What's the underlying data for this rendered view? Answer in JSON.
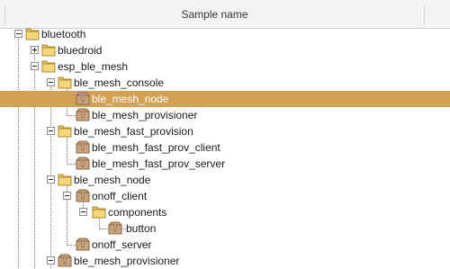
{
  "header": {
    "column_title": "Sample name"
  },
  "tree": {
    "items": [
      {
        "label": "bluetooth",
        "icon": "folder-icon",
        "expander": "minus"
      },
      {
        "label": "bluedroid",
        "icon": "folder-icon",
        "expander": "plus"
      },
      {
        "label": "esp_ble_mesh",
        "icon": "folder-icon",
        "expander": "minus"
      },
      {
        "label": "ble_mesh_console",
        "icon": "folder-icon",
        "expander": "minus"
      },
      {
        "label": "ble_mesh_node",
        "icon": "package-icon",
        "expander": "none",
        "selected": true
      },
      {
        "label": "ble_mesh_provisioner",
        "icon": "package-icon",
        "expander": "none"
      },
      {
        "label": "ble_mesh_fast_provision",
        "icon": "folder-icon",
        "expander": "minus"
      },
      {
        "label": "ble_mesh_fast_prov_client",
        "icon": "package-icon",
        "expander": "none"
      },
      {
        "label": "ble_mesh_fast_prov_server",
        "icon": "package-icon",
        "expander": "none"
      },
      {
        "label": "ble_mesh_node",
        "icon": "folder-icon",
        "expander": "minus"
      },
      {
        "label": "onoff_client",
        "icon": "package-icon",
        "expander": "minus"
      },
      {
        "label": "components",
        "icon": "folder-icon",
        "expander": "minus"
      },
      {
        "label": "button",
        "icon": "package-icon",
        "expander": "none"
      },
      {
        "label": "onoff_server",
        "icon": "package-icon",
        "expander": "none"
      },
      {
        "label": "ble_mesh_provisioner",
        "icon": "package-icon",
        "expander": "minus"
      }
    ]
  },
  "colors": {
    "selection": "#d4a153",
    "folder": "#e8c25a",
    "package": "#c9a27a"
  }
}
